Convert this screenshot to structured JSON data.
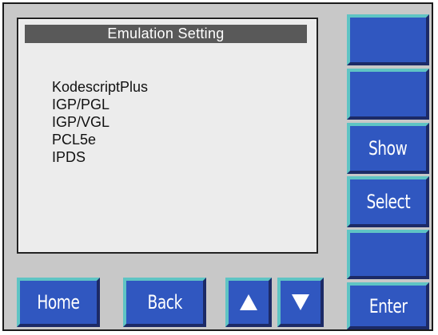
{
  "screen": {
    "title": "Emulation Setting",
    "options": [
      "KodescriptPlus",
      "IGP/PGL",
      "IGP/VGL",
      "PCL5e",
      "IPDS"
    ]
  },
  "side_buttons": {
    "blank_1": "",
    "blank_2": "",
    "show": "Show",
    "select": "Select",
    "blank_3": "",
    "enter": "Enter"
  },
  "bottom_buttons": {
    "home": "Home",
    "back": "Back",
    "up_icon": "up-arrow-icon",
    "down_icon": "down-arrow-icon"
  },
  "colors": {
    "button_face": "#3057c0",
    "button_highlight": "#5fc4c4",
    "panel": "#c8c8c8",
    "screen_bg": "#ececec",
    "title_bar": "#595959"
  }
}
